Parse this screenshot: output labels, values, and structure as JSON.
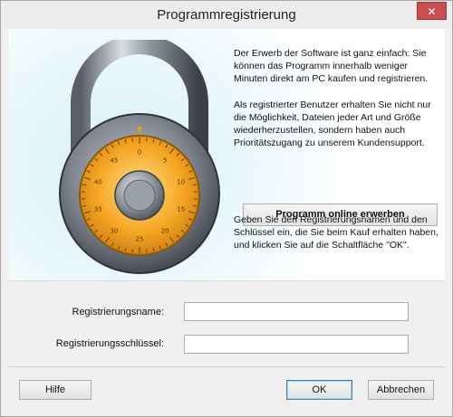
{
  "window": {
    "title": "Programmregistrierung",
    "close_glyph": "✕"
  },
  "info": {
    "paragraph1": "Der Erwerb der Software ist ganz einfach: Sie können das Programm innerhalb weniger Minuten direkt am PC kaufen und registrieren.",
    "paragraph2": "Als registrierter Benutzer erhalten Sie nicht nur die Möglichkeit, Dateien jeder Art und Größe wiederherzustellen, sondern haben auch Prioritätszugang zu unserem Kundensupport.",
    "buy_button": "Programm online erwerben",
    "paragraph3": "Geben Sie den Registrierungsnamen und den Schlüssel ein, die Sie beim Kauf erhalten haben, und klicken Sie auf die Schaltfläche \"OK\"."
  },
  "padlock": {
    "icon": "padlock-combination-icon",
    "dial_numbers": [
      "0",
      "5",
      "10",
      "15",
      "20",
      "25",
      "30",
      "35",
      "40",
      "45"
    ]
  },
  "form": {
    "name_label": "Registrierungsname:",
    "name_value": "",
    "key_label": "Registrierungsschlüssel:",
    "key_value": ""
  },
  "buttons": {
    "help": "Hilfe",
    "ok": "OK",
    "cancel": "Abbrechen"
  },
  "colors": {
    "close_button": "#c74f4f",
    "dial": "#f5a623",
    "ok_border": "#3c7fb1"
  }
}
